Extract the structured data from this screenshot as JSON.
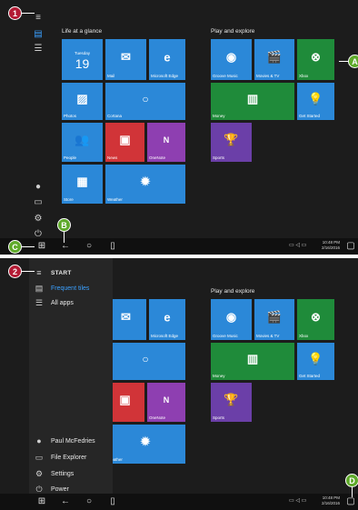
{
  "top": {
    "group1_title": "Life at a glance",
    "group2_title": "Play and explore",
    "tiles": {
      "calendar_day": "Tuesday",
      "calendar_date": "19",
      "mail": "Mail",
      "edge": "Microsoft Edge",
      "photos": "Photos",
      "cortana": "Cortana",
      "people": "People",
      "news": "News",
      "onenote": "OneNote",
      "store": "Store",
      "weather": "Weather",
      "groove": "Groove Music",
      "movies": "Movies & TV",
      "xbox": "Xbox",
      "money": "Money",
      "getstarted": "Get Started",
      "sports": "Sports"
    }
  },
  "bottom": {
    "menu": {
      "start": "START",
      "most_used": "Frequent tiles",
      "all_apps": "All apps",
      "user": "Paul McFedries",
      "file_explorer": "File Explorer",
      "settings": "Settings",
      "power": "Power"
    },
    "group2_title": "Play and explore",
    "tiles": {
      "edge": "Microsoft Edge",
      "cortana_partial": "na",
      "onenote": "OneNote",
      "weather": "Weather",
      "groove": "Groove Music",
      "movies": "Movies & TV",
      "xbox": "Xbox",
      "money": "Money",
      "getstarted": "Get Started",
      "sports": "Sports"
    }
  },
  "taskbar": {
    "time": "10:48 PM",
    "date": "2/16/2016"
  },
  "callouts": [
    "1",
    "2",
    "A",
    "B",
    "C",
    "D"
  ],
  "icons": [
    "hamburger-icon",
    "windows-logo-icon",
    "back-arrow-icon",
    "search-circle-icon",
    "task-view-icon",
    "action-center-icon"
  ]
}
